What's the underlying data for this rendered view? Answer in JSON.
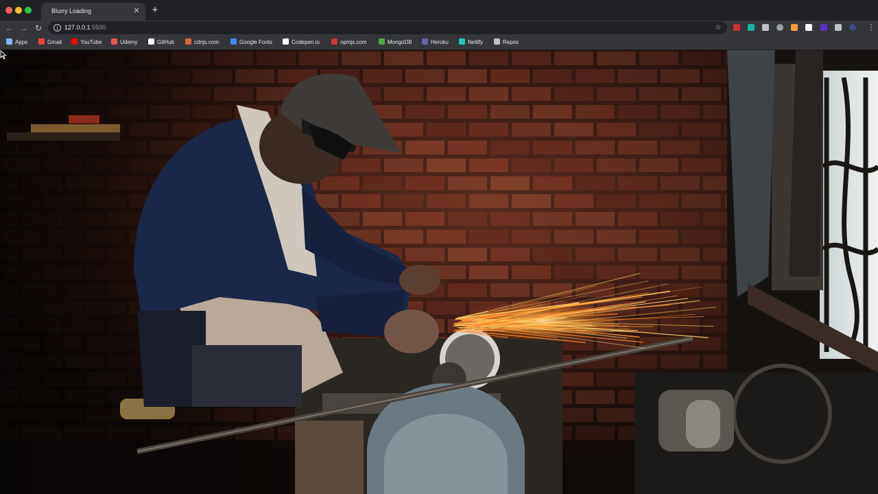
{
  "browser": {
    "tab_title": "Blurry Loading",
    "url_host": "127.0.0.1",
    "url_port": ":5500",
    "colors": {
      "tabstrip": "#202124",
      "toolbar": "#35363a",
      "omnibox": "#202124"
    }
  },
  "bookmarks": [
    {
      "label": "Apps",
      "icon": "apps-grid-icon",
      "color": "#8ab4f8"
    },
    {
      "label": "Gmail",
      "icon": "gmail-icon",
      "color": "#ea4335"
    },
    {
      "label": "YouTube",
      "icon": "youtube-icon",
      "color": "#ff0000"
    },
    {
      "label": "Udemy",
      "icon": "udemy-icon",
      "color": "#ec5252"
    },
    {
      "label": "GitHub",
      "icon": "github-icon",
      "color": "#ffffff"
    },
    {
      "label": "cdnjs.com",
      "icon": "cdnjs-icon",
      "color": "#d9643a"
    },
    {
      "label": "Google Fonts",
      "icon": "google-fonts-icon",
      "color": "#4285f4"
    },
    {
      "label": "Codepen.io",
      "icon": "codepen-icon",
      "color": "#ffffff"
    },
    {
      "label": "npmjs.com",
      "icon": "npm-icon",
      "color": "#cb3837"
    },
    {
      "label": "MongoDB",
      "icon": "mongodb-icon",
      "color": "#4faa41"
    },
    {
      "label": "Heroku",
      "icon": "heroku-icon",
      "color": "#6762a6"
    },
    {
      "label": "Netlify",
      "icon": "netlify-icon",
      "color": "#20c6b7"
    },
    {
      "label": "Repos",
      "icon": "folder-icon",
      "color": "#bdc1c6"
    }
  ],
  "extensions": [
    {
      "icon": "extension-red-icon",
      "color": "#d32f2f"
    },
    {
      "icon": "extension-teal-icon",
      "color": "#17b3a3"
    },
    {
      "icon": "extension-gear-icon",
      "color": "#bdc1c6"
    },
    {
      "icon": "extension-circle-icon",
      "color": "#9aa0a6"
    },
    {
      "icon": "extension-orange-icon",
      "color": "#f0a030"
    },
    {
      "icon": "extension-white-icon",
      "color": "#ffffff"
    },
    {
      "icon": "extension-purple-icon",
      "color": "#5b2fc9"
    },
    {
      "icon": "puzzle-icon",
      "color": "#bdc1c6"
    },
    {
      "icon": "profile-avatar-icon",
      "color": "#3c4b8a"
    }
  ]
}
